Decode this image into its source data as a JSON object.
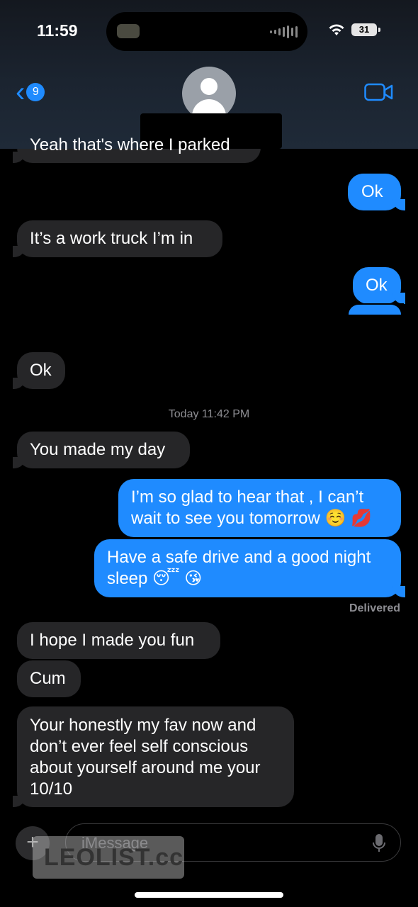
{
  "status_bar": {
    "time": "11:59",
    "battery": "31"
  },
  "header": {
    "back_badge": "9"
  },
  "partial_top_message": "Yeah that's where I parked",
  "messages": [
    {
      "text": "Ok",
      "dir": "out"
    },
    {
      "text": "It’s a work truck I’m in",
      "dir": "in"
    },
    {
      "text": "Ok",
      "dir": "out"
    },
    {
      "text": "Ok",
      "dir": "in"
    },
    {
      "text": "You made my day",
      "dir": "in"
    },
    {
      "text": "I’m so glad to hear that , I can’t wait to see you tomorrow ☺️ 💋",
      "dir": "out"
    },
    {
      "text": "Have a safe drive and a good night sleep 😴 😘",
      "dir": "out"
    },
    {
      "text": "I hope I made you fun",
      "dir": "in"
    },
    {
      "text": "Cum",
      "dir": "in"
    },
    {
      "text": "Your honestly my fav now and don’t ever feel self conscious about yourself around me your 10/10",
      "dir": "in"
    }
  ],
  "timestamp": "Today 11:42 PM",
  "delivered_label": "Delivered",
  "input": {
    "placeholder": "iMessage"
  },
  "watermark": "LEOLIST.cc",
  "colors": {
    "outgoing": "#1f8bff",
    "incoming": "#262628",
    "background": "#000000"
  },
  "icons": [
    "wifi-icon",
    "battery-icon",
    "back-chevron-icon",
    "avatar-icon",
    "video-call-icon",
    "plus-icon",
    "mic-icon"
  ]
}
